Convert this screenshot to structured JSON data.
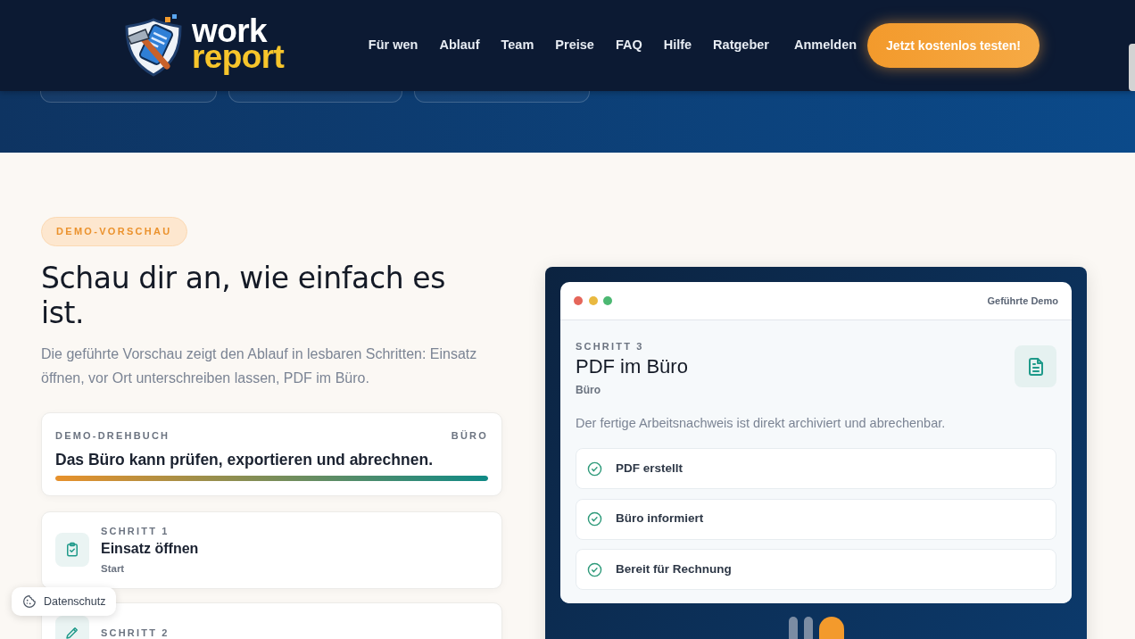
{
  "header": {
    "logo": {
      "line1": "work",
      "line2": "report"
    },
    "nav": [
      {
        "label": "Für wen"
      },
      {
        "label": "Ablauf"
      },
      {
        "label": "Team"
      },
      {
        "label": "Preise"
      },
      {
        "label": "FAQ"
      },
      {
        "label": "Hilfe"
      },
      {
        "label": "Ratgeber"
      }
    ],
    "login": "Anmelden",
    "cta": "Jetzt kostenlos testen!"
  },
  "intro": {
    "badge": "DEMO-VORSCHAU",
    "heading": "Schau dir an, wie einfach es ist.",
    "text": "Die geführte Vorschau zeigt den Ablauf in lesbaren Schritten: Einsatz öffnen, vor Ort unterschreiben lassen, PDF im Büro."
  },
  "script_card": {
    "label": "DEMO-DREHBUCH",
    "role": "BÜRO",
    "title": "Das Büro kann prüfen, exportieren und abrechnen.",
    "level": 1
  },
  "steps": [
    {
      "label": "SCHRITT 1",
      "title": "Einsatz öffnen",
      "subtitle": "Start"
    },
    {
      "label": "SCHRITT 2"
    }
  ],
  "demo_window": {
    "controls": [
      {
        "color": "#e5665a"
      },
      {
        "color": "#e9b940"
      },
      {
        "color": "#4cb872"
      }
    ],
    "title": "Geführte Demo",
    "step_label": "SCHRITT 3",
    "step_title": "PDF im Büro",
    "step_role": "Büro",
    "description": "Der fertige Arbeitsnachweis ist direkt archiviert und abrechenbar.",
    "checklist": [
      {
        "label": "PDF erstellt",
        "checked": true
      },
      {
        "label": "Büro informiert",
        "checked": true
      },
      {
        "label": "Bereit für Rechnung",
        "checked": true
      }
    ],
    "progress": [
      {
        "selected": false
      },
      {
        "selected": false
      },
      {
        "selected": true
      }
    ]
  },
  "privacy_button": "Datenschutz"
}
